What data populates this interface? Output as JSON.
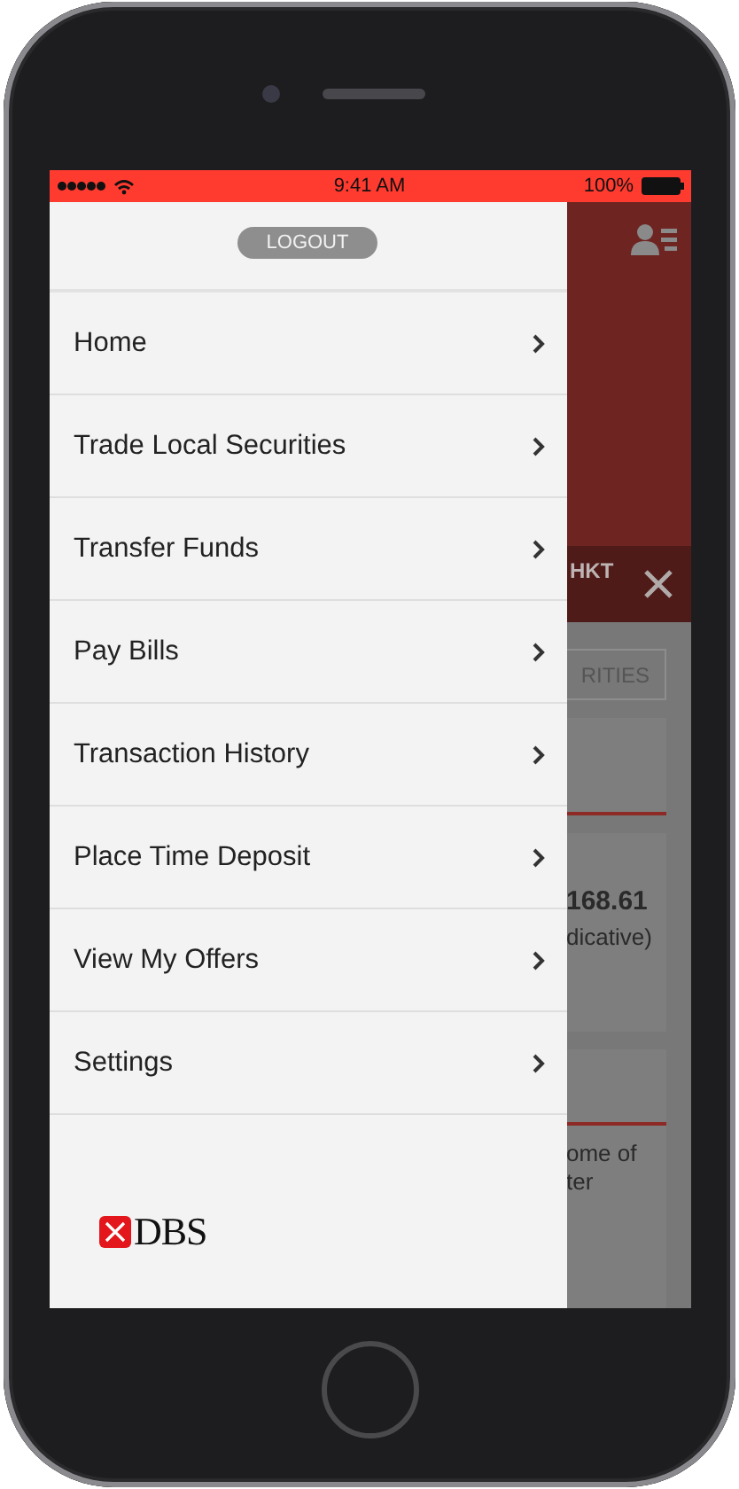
{
  "status_bar": {
    "time": "9:41 AM",
    "battery": "100%"
  },
  "drawer": {
    "logout": "LOGOUT",
    "items": [
      {
        "label": "Home"
      },
      {
        "label": "Trade Local Securities"
      },
      {
        "label": "Transfer Funds"
      },
      {
        "label": "Pay Bills"
      },
      {
        "label": "Transaction History"
      },
      {
        "label": "Place Time Deposit"
      },
      {
        "label": "View My Offers"
      },
      {
        "label": "Settings"
      }
    ],
    "logo": "DBS"
  },
  "background": {
    "header_label": "HKT",
    "tab_label": "RITIES",
    "amount": "168.61",
    "amount_note": "dicative)",
    "note_lines": [
      "ome of",
      "ter"
    ]
  }
}
